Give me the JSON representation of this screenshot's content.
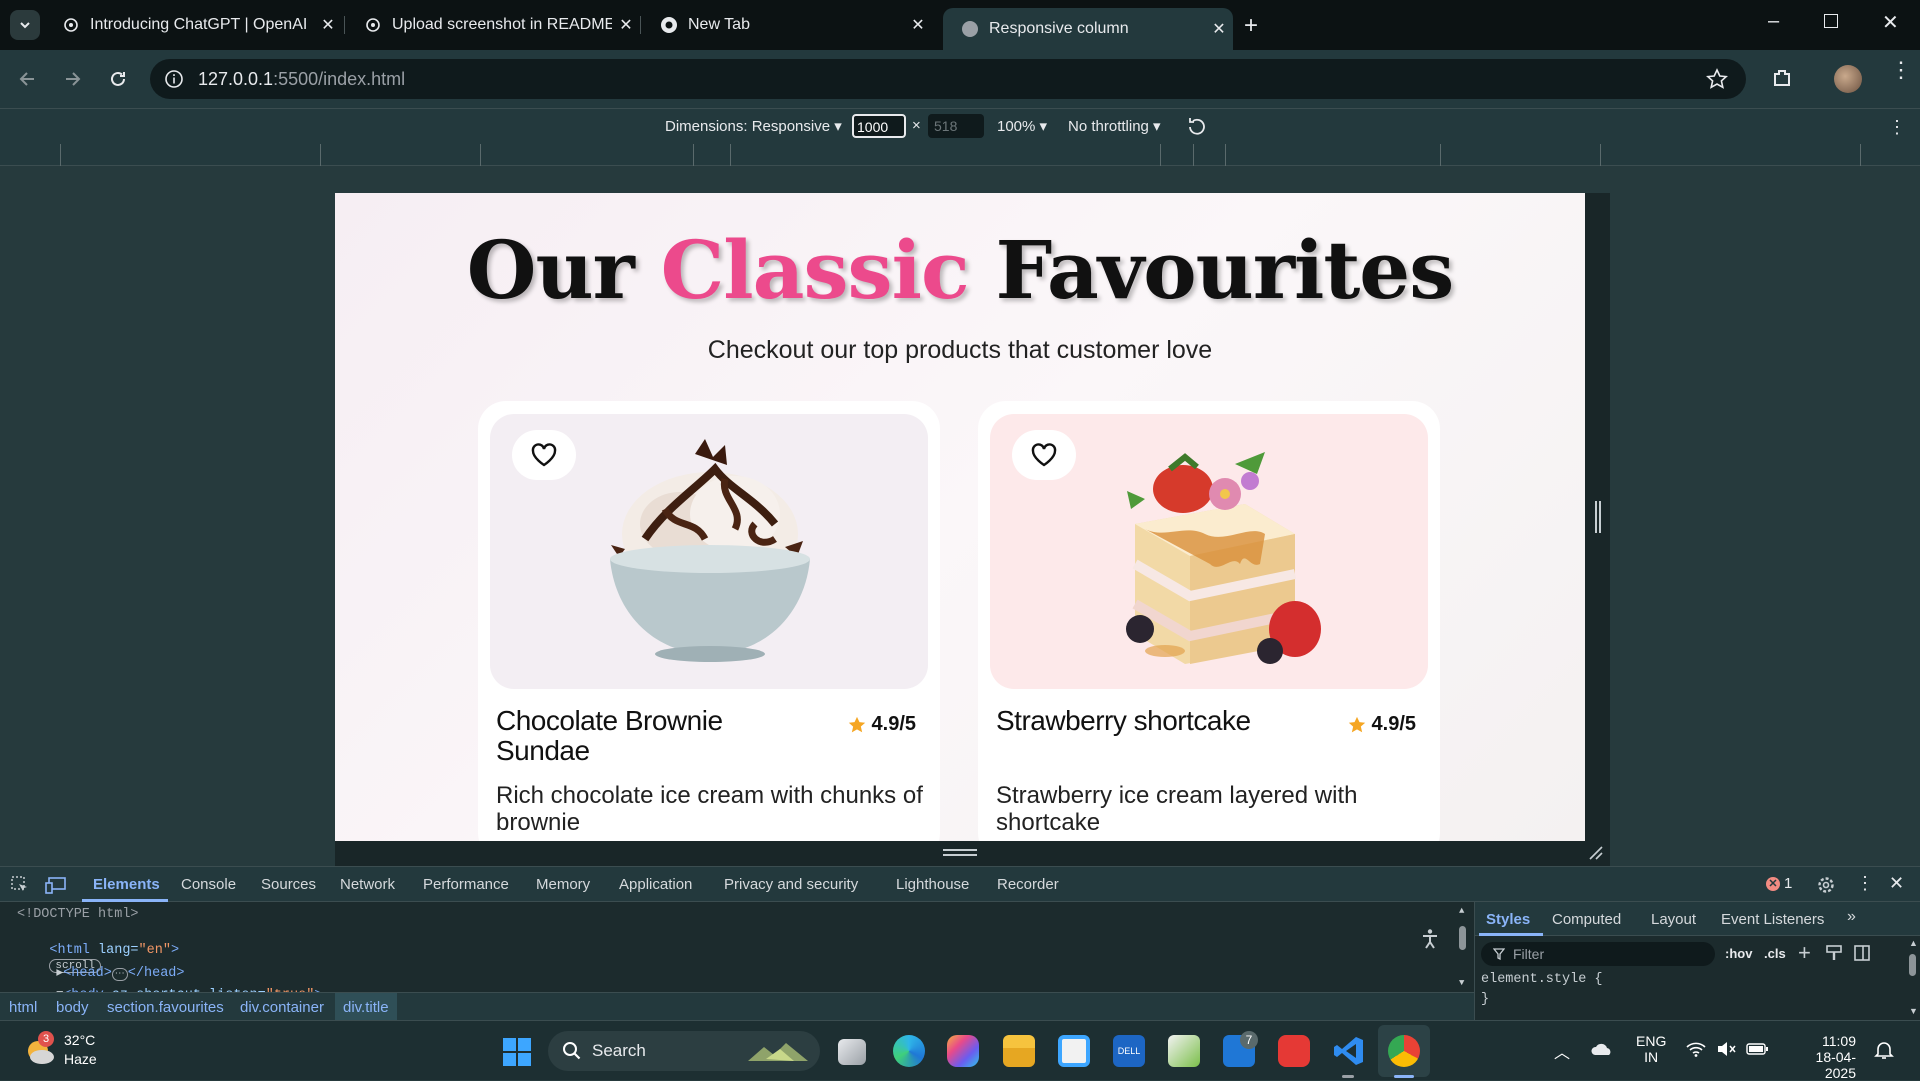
{
  "tabs": [
    {
      "title": "Introducing ChatGPT | OpenAI",
      "icon": "openai-icon"
    },
    {
      "title": "Upload screenshot in README",
      "icon": "openai-icon"
    },
    {
      "title": "New Tab",
      "icon": "chrome-icon"
    },
    {
      "title": "Responsive column",
      "icon": "globe-icon",
      "active": true
    }
  ],
  "address": {
    "host": "127.0.0.1",
    "rest": ":5500/index.html"
  },
  "device": {
    "dimensions": "Dimensions: Responsive",
    "width": "1000",
    "times": "×",
    "height_placeholder": "518",
    "zoom": "100%",
    "throttling": "No throttling"
  },
  "page": {
    "title_part1": "Our",
    "title_part2": "Classic",
    "title_part3": "Favourites",
    "subtitle": "Checkout our top products that customer love",
    "products": [
      {
        "name": "Chocolate Brownie Sundae",
        "rating": "4.9/5",
        "description": "Rich chocolate ice cream with chunks of brownie",
        "bg": "#f3eef3"
      },
      {
        "name": "Strawberry shortcake",
        "rating": "4.9/5",
        "description": "Strawberry ice cream layered with shortcake",
        "bg": "#fde9ea"
      }
    ]
  },
  "devtools": {
    "tabs": [
      "Elements",
      "Console",
      "Sources",
      "Network",
      "Performance",
      "Memory",
      "Application",
      "Privacy and security",
      "Lighthouse",
      "Recorder"
    ],
    "error_count": "1",
    "dom_lines": {
      "l1": "<!DOCTYPE html>",
      "l2_tag": "<html",
      "l2_attr": " lang=",
      "l2_val": "\"en\"",
      "l2_close": ">",
      "l2_badge": "scroll",
      "l3_open": "<head>",
      "l3_ellipsis": "⋯",
      "l3_close": "</head>",
      "l4_tag": "<body",
      "l4_attr": " cz-shortcut-listen=",
      "l4_val": "\"true\"",
      "l4_close": ">"
    },
    "breadcrumbs": [
      "html",
      "body",
      "section.favourites",
      "div.container",
      "div.title"
    ],
    "styles_tabs": [
      "Styles",
      "Computed",
      "Layout",
      "Event Listeners"
    ],
    "filter_placeholder": "Filter",
    "hov": ":hov",
    "cls": ".cls",
    "element_style": "element.style {",
    "close_brace": "}"
  },
  "taskbar": {
    "weather_temp": "32°C",
    "weather_desc": "Haze",
    "weather_badge": "3",
    "search_label": "Search",
    "lang_top": "ENG",
    "lang_bottom": "IN",
    "time": "11:09",
    "date": "18-04-2025",
    "badge_7": "7"
  },
  "colors": {
    "accent_pink": "#ec4a8c",
    "star": "#f5a623",
    "devtools_bg": "#23393d"
  }
}
